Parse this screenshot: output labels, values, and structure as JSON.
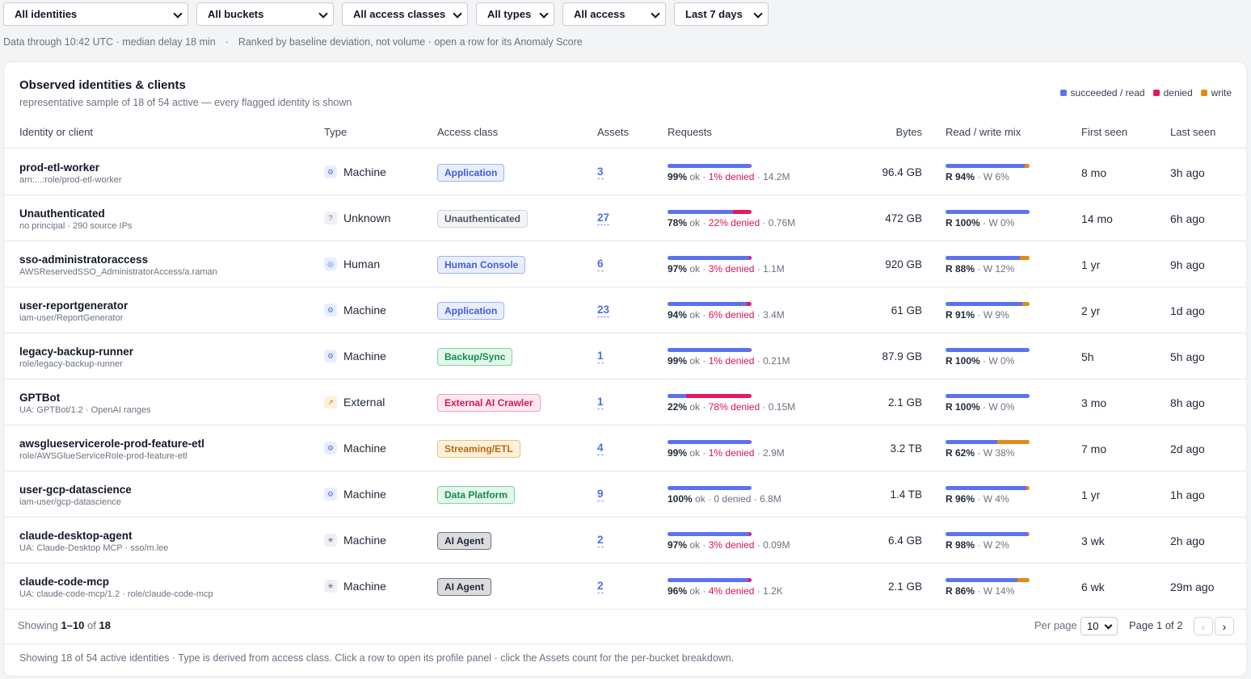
{
  "filters": [
    {
      "label": "All identities",
      "w": 229
    },
    {
      "label": "All buckets",
      "w": 170
    },
    {
      "label": "All access classes",
      "w": 156
    },
    {
      "label": "All types",
      "w": 97
    },
    {
      "label": "All access",
      "w": 128
    },
    {
      "label": "Last 7 days",
      "w": 117
    }
  ],
  "meta": {
    "freshness": "Data through 10:42 UTC · median delay 18 min",
    "sep": "·",
    "ranking": "Ranked by baseline deviation, not volume · open a row for its Anomaly Score"
  },
  "card": {
    "title": "Observed identities & clients",
    "subtitle": "representative sample of 18 of 54 active — every flagged identity is shown"
  },
  "legend": [
    {
      "label": "succeeded / read",
      "color": "#5b72f0"
    },
    {
      "label": "denied",
      "color": "#e8175d"
    },
    {
      "label": "write",
      "color": "#e38a16"
    }
  ],
  "columns": {
    "identity": "Identity or client",
    "type": "Type",
    "access_class": "Access class",
    "assets": "Assets",
    "requests": "Requests",
    "bytes": "Bytes",
    "mix": "Read / write mix",
    "first_seen": "First seen",
    "last_seen": "Last seen"
  },
  "rows": [
    {
      "name": "prod-etl-worker",
      "sub": "arn:...:role/prod-etl-worker",
      "type": "Machine",
      "type_icon": "gear-icon",
      "access_class": "Application",
      "assets": "3",
      "ok": 99,
      "ok_label": "99%",
      "ok_word": "ok",
      "denied_label": "1% denied",
      "denied": 1,
      "req_count": "14.2M",
      "bytes": "96.4 GB",
      "read": 94,
      "read_label": "R 94%",
      "write_label": "W 6%",
      "first_seen": "8 mo",
      "last_seen": "3h ago"
    },
    {
      "name": "Unauthenticated",
      "sub": "no principal · 290 source IPs",
      "type": "Unknown",
      "type_icon": "question-icon",
      "access_class": "Unauthenticated",
      "assets": "27",
      "ok": 78,
      "ok_label": "78%",
      "ok_word": "ok",
      "denied_label": "22% denied",
      "denied": 22,
      "req_count": "0.76M",
      "bytes": "472 GB",
      "read": 100,
      "read_label": "R 100%",
      "write_label": "W 0%",
      "first_seen": "14 mo",
      "last_seen": "6h ago"
    },
    {
      "name": "sso-administratoraccess",
      "sub": "AWSReservedSSO_AdministratorAccess/a.raman",
      "type": "Human",
      "type_icon": "user-icon",
      "access_class": "Human Console",
      "assets": "6",
      "ok": 97,
      "ok_label": "97%",
      "ok_word": "ok",
      "denied_label": "3% denied",
      "denied": 3,
      "req_count": "1.1M",
      "bytes": "920 GB",
      "read": 88,
      "read_label": "R 88%",
      "write_label": "W 12%",
      "first_seen": "1 yr",
      "last_seen": "9h ago"
    },
    {
      "name": "user-reportgenerator",
      "sub": "iam-user/ReportGenerator",
      "type": "Machine",
      "type_icon": "gear-icon",
      "access_class": "Application",
      "assets": "23",
      "ok": 94,
      "ok_label": "94%",
      "ok_word": "ok",
      "denied_label": "6% denied",
      "denied": 6,
      "req_count": "3.4M",
      "bytes": "61 GB",
      "read": 91,
      "read_label": "R 91%",
      "write_label": "W 9%",
      "first_seen": "2 yr",
      "last_seen": "1d ago"
    },
    {
      "name": "legacy-backup-runner",
      "sub": "role/legacy-backup-runner",
      "type": "Machine",
      "type_icon": "gear-icon",
      "access_class": "Backup/Sync",
      "assets": "1",
      "ok": 99,
      "ok_label": "99%",
      "ok_word": "ok",
      "denied_label": "1% denied",
      "denied": 1,
      "req_count": "0.21M",
      "bytes": "87.9 GB",
      "read": 100,
      "read_label": "R 100%",
      "write_label": "W 0%",
      "first_seen": "5h",
      "last_seen": "5h ago"
    },
    {
      "name": "GPTBot",
      "sub": "UA: GPTBot/1.2 · OpenAI ranges",
      "type": "External",
      "type_icon": "arrow-out-icon",
      "access_class": "External AI Crawler",
      "assets": "1",
      "ok": 22,
      "ok_label": "22%",
      "ok_word": "ok",
      "denied_label": "78% denied",
      "denied": 78,
      "req_count": "0.15M",
      "bytes": "2.1 GB",
      "read": 100,
      "read_label": "R 100%",
      "write_label": "W 0%",
      "first_seen": "3 mo",
      "last_seen": "8h ago"
    },
    {
      "name": "awsglueservicerole-prod-feature-etl",
      "sub": "role/AWSGlueServiceRole-prod-feature-etl",
      "type": "Machine",
      "type_icon": "gear-icon",
      "access_class": "Streaming/ETL",
      "assets": "4",
      "ok": 99,
      "ok_label": "99%",
      "ok_word": "ok",
      "denied_label": "1% denied",
      "denied": 1,
      "req_count": "2.9M",
      "bytes": "3.2 TB",
      "read": 62,
      "read_label": "R 62%",
      "write_label": "W 38%",
      "first_seen": "7 mo",
      "last_seen": "2d ago"
    },
    {
      "name": "user-gcp-datascience",
      "sub": "iam-user/gcp-datascience",
      "type": "Machine",
      "type_icon": "gear-icon",
      "access_class": "Data Platform",
      "assets": "9",
      "ok": 100,
      "ok_label": "100%",
      "ok_word": "ok",
      "denied_label": "0 denied",
      "denied": 0,
      "req_count": "6.8M",
      "bytes": "1.4 TB",
      "read": 96,
      "read_label": "R 96%",
      "write_label": "W 4%",
      "first_seen": "1 yr",
      "last_seen": "1h ago"
    },
    {
      "name": "claude-desktop-agent",
      "sub": "UA: Claude-Desktop MCP · sso/m.lee",
      "type": "Machine",
      "type_icon": "asterisk-icon",
      "access_class": "AI Agent",
      "assets": "2",
      "ok": 97,
      "ok_label": "97%",
      "ok_word": "ok",
      "denied_label": "3% denied",
      "denied": 3,
      "req_count": "0.09M",
      "bytes": "6.4 GB",
      "read": 98,
      "read_label": "R 98%",
      "write_label": "W 2%",
      "first_seen": "3 wk",
      "last_seen": "2h ago"
    },
    {
      "name": "claude-code-mcp",
      "sub": "UA: claude-code-mcp/1.2 · role/claude-code-mcp",
      "type": "Machine",
      "type_icon": "asterisk-icon",
      "access_class": "AI Agent",
      "assets": "2",
      "ok": 96,
      "ok_label": "96%",
      "ok_word": "ok",
      "denied_label": "4% denied",
      "denied": 4,
      "req_count": "1.2K",
      "bytes": "2.1 GB",
      "read": 86,
      "read_label": "R 86%",
      "write_label": "W 14%",
      "first_seen": "6 wk",
      "last_seen": "29m ago"
    }
  ],
  "badge_styles": {
    "Application": {
      "bg": "#e8eefe",
      "border": "#9fb3f3",
      "fg": "#3f5ed8"
    },
    "Unauthenticated": {
      "bg": "#f3f4f6",
      "border": "#d1d5db",
      "fg": "#4b5563"
    },
    "Human Console": {
      "bg": "#e8eefe",
      "border": "#9fb3f3",
      "fg": "#3f5ed8"
    },
    "Backup/Sync": {
      "bg": "#e3f7ec",
      "border": "#7fd3a2",
      "fg": "#178a4a"
    },
    "External AI Crawler": {
      "bg": "#fde8f0",
      "border": "#f2a3c0",
      "fg": "#d01a5e"
    },
    "Streaming/ETL": {
      "bg": "#fdf1dc",
      "border": "#efc27a",
      "fg": "#b9690c"
    },
    "Data Platform": {
      "bg": "#e3f7ec",
      "border": "#7fd3a2",
      "fg": "#178a4a"
    },
    "AI Agent": {
      "bg": "#dcdcdf",
      "border": "#6b7280",
      "fg": "#1f2937"
    }
  },
  "type_icons": {
    "gear-icon": {
      "glyph": "⚙",
      "bg": "#e8eefe",
      "fg": "#4f6fe6"
    },
    "question-icon": {
      "glyph": "?",
      "bg": "#eef0f3",
      "fg": "#6b7280"
    },
    "user-icon": {
      "glyph": "◎",
      "bg": "#e8eefe",
      "fg": "#4f6fe6"
    },
    "arrow-out-icon": {
      "glyph": "↗",
      "bg": "#fdf1dc",
      "fg": "#c97a10"
    },
    "asterisk-icon": {
      "glyph": "✳",
      "bg": "#eef0f3",
      "fg": "#4b5563"
    }
  },
  "footer": {
    "showing_prefix": "Showing ",
    "showing_range": "1–10",
    "showing_of": " of ",
    "showing_total": "18",
    "per_page_label": "Per page",
    "per_page_value": "10",
    "page_info": "Page 1 of 2",
    "prev": "‹",
    "next": "›",
    "note": "Showing 18 of 54 active identities · Type is derived from access class. Click a row to open its profile panel · click the Assets count for the per-bucket breakdown."
  }
}
